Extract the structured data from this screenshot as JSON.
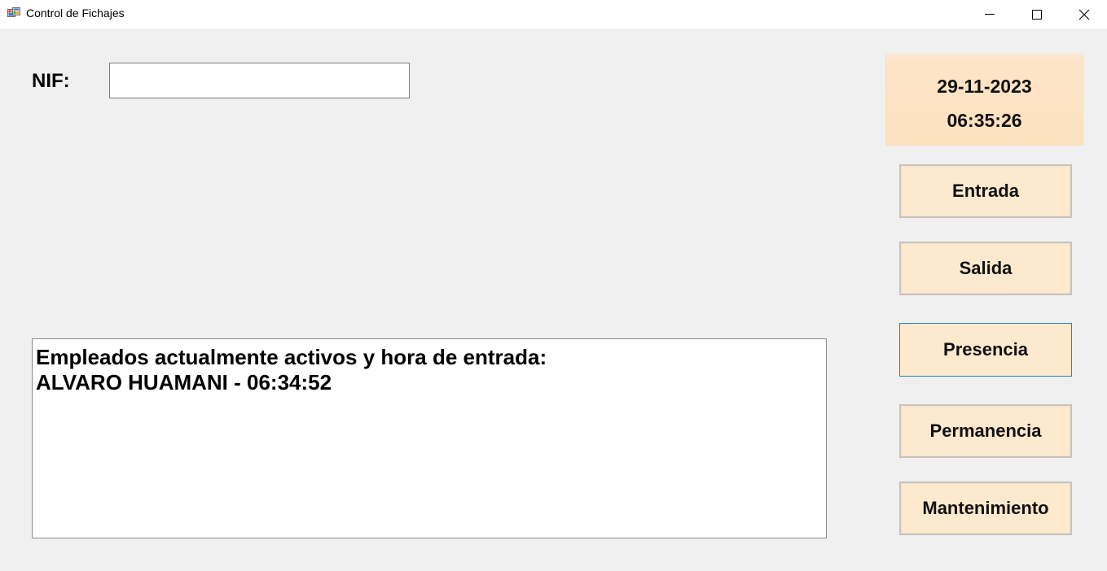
{
  "window": {
    "title": "Control de Fichajes",
    "icon": "app-form-icon"
  },
  "form": {
    "nif_label": "NIF:",
    "nif_value": "",
    "nif_placeholder": ""
  },
  "clock": {
    "date": "29-11-2023",
    "time": "06:35:26"
  },
  "buttons": {
    "entrada": "Entrada",
    "salida": "Salida",
    "presencia": "Presencia",
    "permanencia": "Permanencia",
    "mantenimiento": "Mantenimiento"
  },
  "active_list": {
    "header": "Empleados actualmente activos y hora de entrada:",
    "entries": [
      "ALVARO HUAMANI - 06:34:52"
    ]
  },
  "colors": {
    "window_bg": "#f0f0f0",
    "button_bg": "#fde9cd",
    "clock_bg": "#fde2c0",
    "focus_border": "#2a7fd6"
  }
}
